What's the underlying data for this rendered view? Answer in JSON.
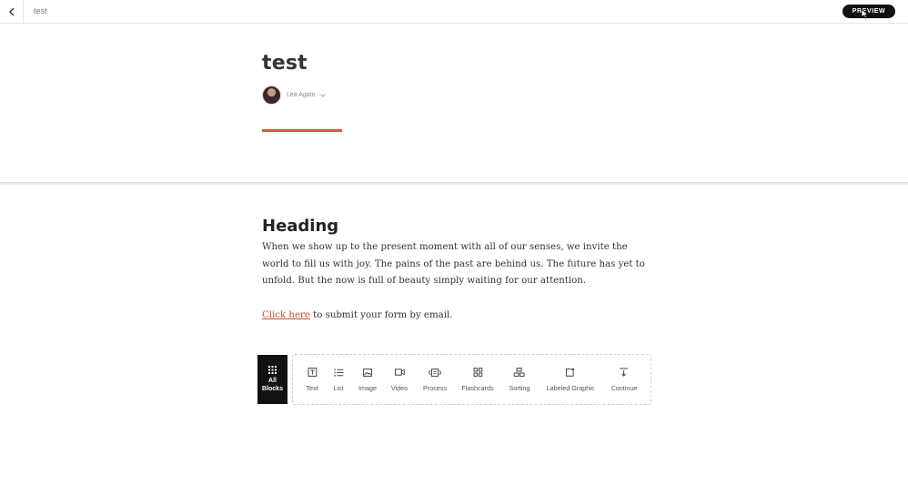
{
  "topbar": {
    "title": "test",
    "preview_label": "PREVIEW"
  },
  "lesson": {
    "title": "test",
    "author": "Lea Agato"
  },
  "content": {
    "heading": "Heading",
    "paragraph": "When we show up to the present moment with all of our senses, we invite the world to fill us with joy. The pains of the past are behind us. The future has yet to unfold. But the now is full of beauty simply waiting for our attention.",
    "link_text": "Click here",
    "link_suffix": " to submit your form by email."
  },
  "block_toolbar": {
    "all_blocks": [
      "All",
      "Blocks"
    ],
    "items": [
      {
        "label": "Text",
        "icon": "text-block-icon"
      },
      {
        "label": "List",
        "icon": "list-icon"
      },
      {
        "label": "Image",
        "icon": "image-icon"
      },
      {
        "label": "Video",
        "icon": "video-icon"
      },
      {
        "label": "Process",
        "icon": "process-icon"
      },
      {
        "label": "Flashcards",
        "icon": "flashcards-icon"
      },
      {
        "label": "Sorting",
        "icon": "sorting-icon"
      },
      {
        "label": "Labeled Graphic",
        "icon": "labeled-graphic-icon"
      },
      {
        "label": "Continue",
        "icon": "continue-icon"
      }
    ]
  },
  "colors": {
    "accent": "#d2603a",
    "link": "#c2502d",
    "dark": "#111111"
  }
}
